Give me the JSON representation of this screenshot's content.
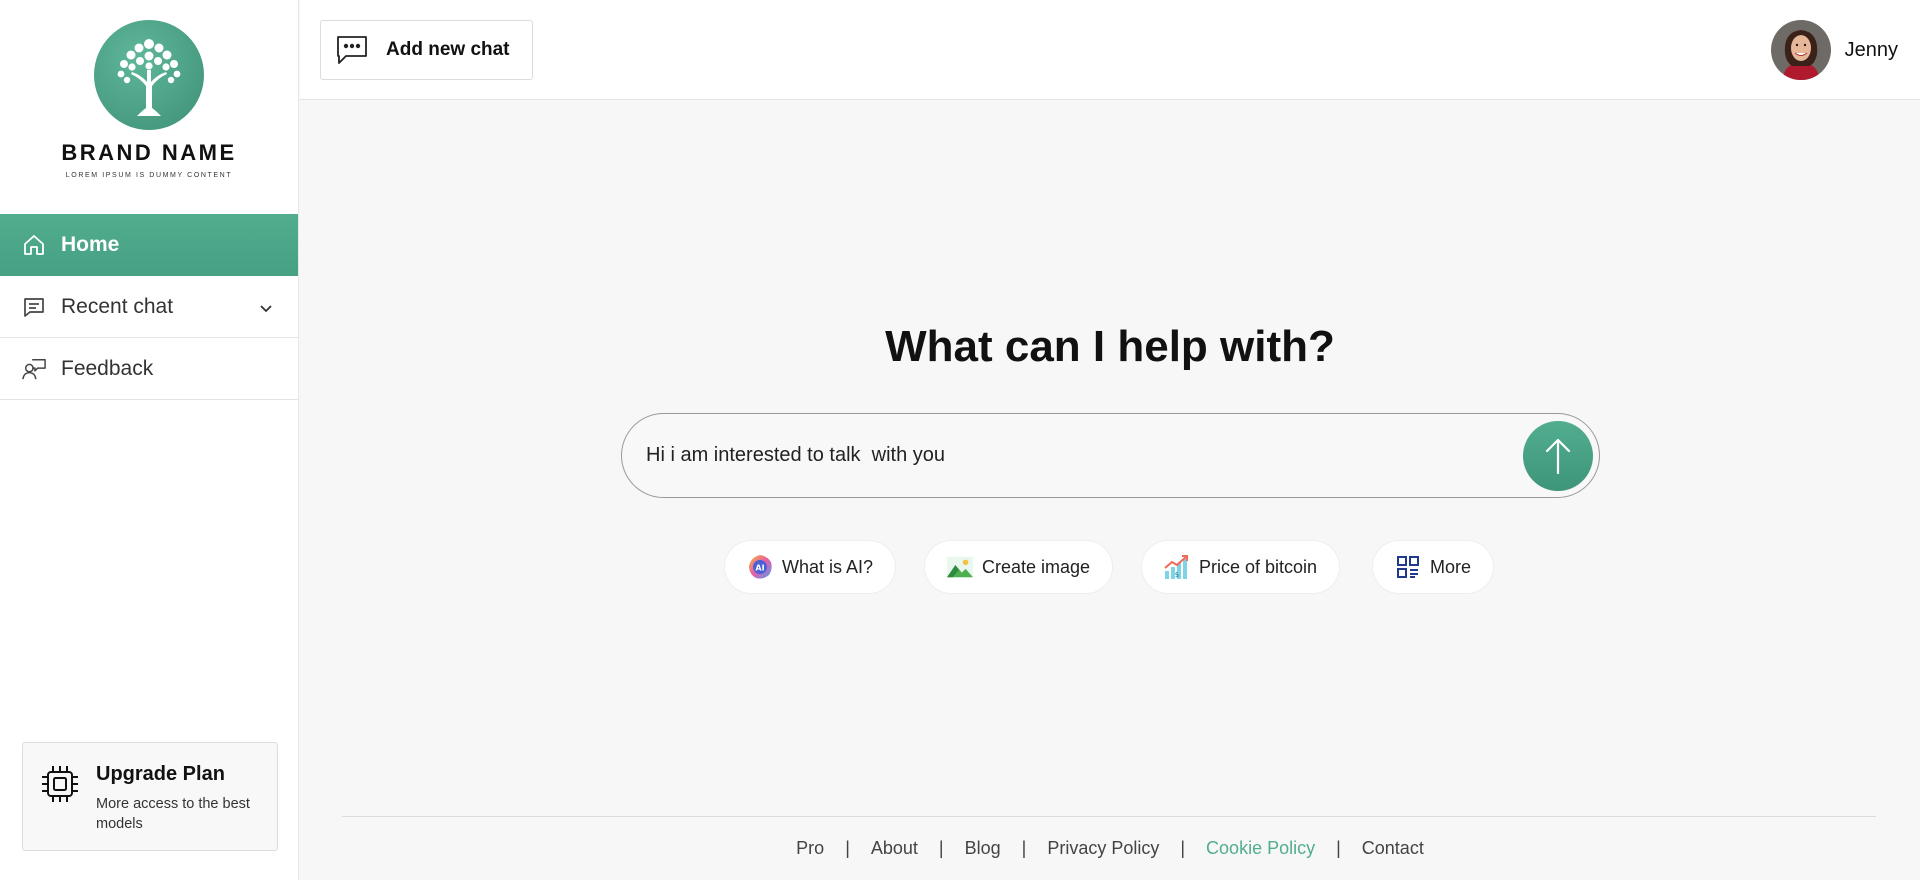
{
  "brand": {
    "name": "BRAND NAME",
    "tagline": "LOREM IPSUM IS DUMMY CONTENT"
  },
  "sidebar": {
    "items": [
      {
        "label": "Home",
        "icon": "home-icon",
        "active": true
      },
      {
        "label": "Recent chat",
        "icon": "chat-list-icon"
      },
      {
        "label": "Feedback",
        "icon": "feedback-icon"
      }
    ],
    "upgrade": {
      "title": "Upgrade Plan",
      "description": "More access to the best models"
    }
  },
  "header": {
    "add_chat_label": "Add new chat",
    "user_name": "Jenny"
  },
  "main": {
    "title": "What can I help with?",
    "input_value": "Hi i am interested to talk  with you",
    "suggestions": [
      {
        "label": "What is AI?",
        "icon": "ai-badge-icon"
      },
      {
        "label": "Create image",
        "icon": "image-icon"
      },
      {
        "label": "Price of bitcoin",
        "icon": "chart-growth-icon"
      },
      {
        "label": "More",
        "icon": "grid-icon"
      }
    ]
  },
  "footer": {
    "links": [
      "Pro",
      "About",
      "Blog",
      "Privacy Policy",
      "Cookie Policy",
      "Contact"
    ],
    "highlight_link": "Cookie Policy",
    "separator": "|"
  },
  "colors": {
    "accent": "#4ea78a",
    "background": "#f7f7f7"
  }
}
